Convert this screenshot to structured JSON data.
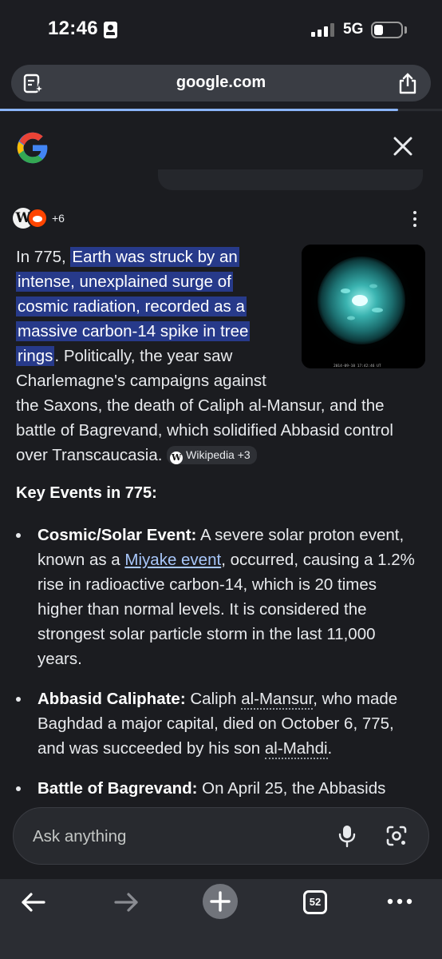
{
  "status_bar": {
    "time": "12:46",
    "network": "5G",
    "icons": [
      "id-card-icon",
      "signal-icon",
      "battery-icon"
    ]
  },
  "browser": {
    "url": "google.com",
    "load_progress_percent": 90,
    "icons": {
      "left": "tab-ai-icon",
      "right": "share-icon"
    }
  },
  "header": {
    "icons": [
      "google-logo",
      "close-icon"
    ]
  },
  "sources": {
    "more_count": "+6"
  },
  "answer": {
    "lines": [
      {
        "plain": "In 775, ",
        "highlight": "Earth was struck by an"
      },
      {
        "highlight": "intense, unexplained surge of"
      },
      {
        "highlight": "cosmic radiation, recorded as a"
      },
      {
        "highlight": "massive carbon-14 spike in tree"
      },
      {
        "highlight": "rings",
        "plain": ". Politically, the year saw"
      },
      {
        "plain": "Charlemagne's campaigns against"
      },
      {
        "plain": "the Saxons, the death of Caliph al-Mansur, and the"
      },
      {
        "plain": "battle of Bagrevand, which solidified Abbasid control"
      },
      {
        "plain": "over Transcaucasia. "
      }
    ],
    "citation_chip": "Wikipedia +3",
    "image_caption": "sun-flare-image",
    "image_timestamp": "2014-09-10 17:42:46 UT"
  },
  "key_events": {
    "heading": "Key Events in 775:",
    "items": [
      {
        "title": "Cosmic/Solar Event:",
        "lines": [
          {
            "a": " A severe solar proton event,"
          },
          {
            "a": "known as a ",
            "link": "Miyake event",
            "b": ", occurred, causing a 1.2%"
          },
          {
            "a": "rise in radioactive carbon-14, which is 20 times"
          },
          {
            "a": "higher than normal levels. It is considered the"
          },
          {
            "a": "strongest solar particle storm in the last 11,000"
          },
          {
            "a": "years."
          }
        ]
      },
      {
        "title": "Abbasid Caliphate:",
        "lines": [
          {
            "a": " Caliph ",
            "dotted": "al-Mansur",
            "b": ", who made"
          },
          {
            "a": "Baghdad a major capital, died on October 6, 775,"
          },
          {
            "a": "and was succeeded by his son ",
            "dotted": "al-Mahdi",
            "b": "."
          }
        ]
      },
      {
        "title": "Battle of Bagrevand:",
        "lines": [
          {
            "a": " On April 25, the Abbasids"
          }
        ]
      }
    ]
  },
  "ask": {
    "placeholder": "Ask anything",
    "icons": [
      "mic-icon",
      "lens-icon"
    ]
  },
  "bottom_nav": {
    "tab_count": "52",
    "icons": [
      "back-icon",
      "forward-icon",
      "new-tab-icon",
      "tabs-icon",
      "more-icon"
    ]
  },
  "colors": {
    "highlight": "#273a8a",
    "link": "#a8c7fa",
    "background": "#1b1c20"
  }
}
